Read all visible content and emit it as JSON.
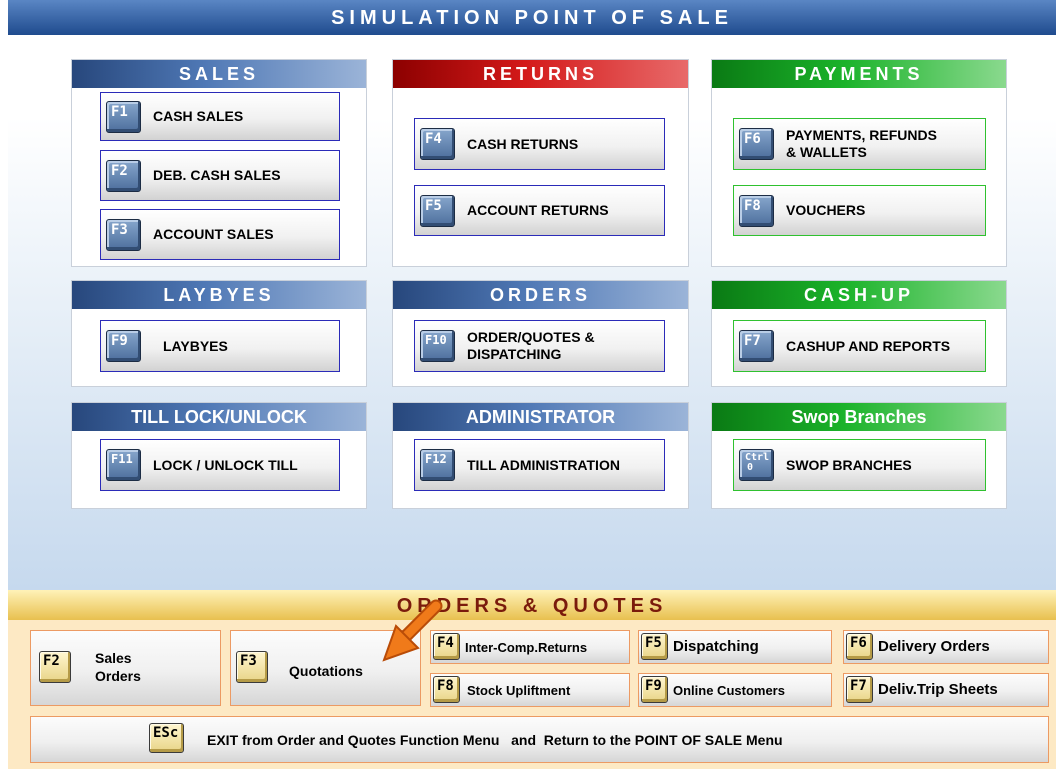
{
  "title": "SIMULATION POINT OF SALE",
  "panels": {
    "sales": {
      "header": "SALES",
      "buttons": [
        {
          "key": "F1",
          "label": "CASH SALES"
        },
        {
          "key": "F2",
          "label": "DEB. CASH SALES"
        },
        {
          "key": "F3",
          "label": "ACCOUNT SALES"
        }
      ]
    },
    "returns": {
      "header": "RETURNS",
      "buttons": [
        {
          "key": "F4",
          "label": "CASH  RETURNS"
        },
        {
          "key": "F5",
          "label": "ACCOUNT RETURNS"
        }
      ]
    },
    "payments": {
      "header": "PAYMENTS",
      "buttons": [
        {
          "key": "F6",
          "label_line1": "PAYMENTS, REFUNDS",
          "label_line2": "& WALLETS"
        },
        {
          "key": "F8",
          "label": "VOUCHERS"
        }
      ]
    },
    "laybyes": {
      "header": "LAYBYES",
      "buttons": [
        {
          "key": "F9",
          "label": "LAYBYES"
        }
      ]
    },
    "orders": {
      "header": "ORDERS",
      "buttons": [
        {
          "key": "F10",
          "label_line1": "ORDER/QUOTES &",
          "label_line2": "DISPATCHING"
        }
      ]
    },
    "cashup": {
      "header": "CASH-UP",
      "buttons": [
        {
          "key": "F7",
          "label": "CASHUP AND REPORTS"
        }
      ]
    },
    "till_lock": {
      "header": "TILL LOCK/UNLOCK",
      "buttons": [
        {
          "key": "F11",
          "label": "LOCK / UNLOCK TILL"
        }
      ]
    },
    "administrator": {
      "header": "ADMINISTRATOR",
      "buttons": [
        {
          "key": "F12",
          "label": "TILL ADMINISTRATION"
        }
      ]
    },
    "swop": {
      "header": "Swop Branches",
      "buttons": [
        {
          "key_line1": "Ctrl",
          "key_line2": "0",
          "label": "SWOP BRANCHES"
        }
      ]
    }
  },
  "orders_quotes": {
    "header": "ORDERS & QUOTES",
    "sales_orders": {
      "key": "F2",
      "line1": "Sales",
      "line2": "Orders"
    },
    "quotations": {
      "key": "F3",
      "label": "Quotations"
    },
    "inter_comp": {
      "key": "F4",
      "label": "Inter-Comp.Returns"
    },
    "stock_uplift": {
      "key": "F8",
      "label": "Stock Upliftment"
    },
    "dispatching": {
      "key": "F5",
      "label": "Dispatching"
    },
    "online_customers": {
      "key": "F9",
      "label": "Online Customers"
    },
    "delivery_orders": {
      "key": "F6",
      "label": "Delivery Orders"
    },
    "deliv_trip": {
      "key": "F7",
      "label": "Deliv.Trip Sheets"
    },
    "exit": {
      "key": "ESc",
      "label": "EXIT from Order and Quotes Function Menu   and  Return to the POINT OF SALE Menu"
    }
  },
  "colors": {
    "title_blue": "#1f4b8e",
    "returns_red": "#d41a1a",
    "payments_green": "#1bb32a",
    "orders_quotes_gold": "#e8c04f",
    "arrow_orange": "#f07a1a"
  }
}
